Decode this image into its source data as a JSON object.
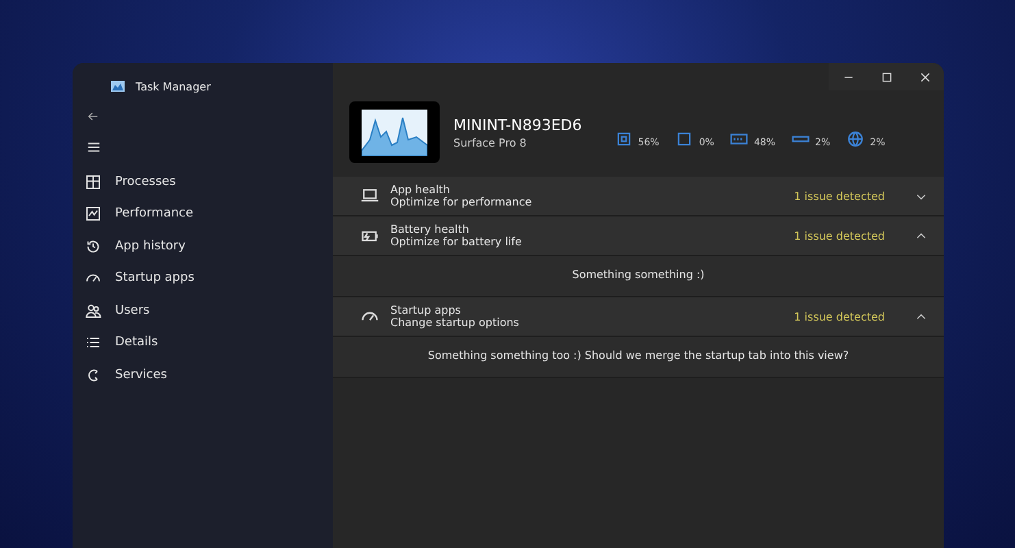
{
  "window": {
    "title": "Task Manager"
  },
  "sidebar": {
    "items": [
      {
        "label": "Processes"
      },
      {
        "label": "Performance"
      },
      {
        "label": "App history"
      },
      {
        "label": "Startup apps"
      },
      {
        "label": "Users"
      },
      {
        "label": "Details"
      },
      {
        "label": "Services"
      }
    ]
  },
  "device": {
    "name": "MININT-N893ED6",
    "model": "Surface Pro 8"
  },
  "metrics": [
    {
      "reading": "56%"
    },
    {
      "reading": "0%"
    },
    {
      "reading": "48%"
    },
    {
      "reading": "2%"
    },
    {
      "reading": "2%"
    }
  ],
  "sections": [
    {
      "title": "App health",
      "subtitle": "Optimize for performance",
      "status": "1 issue detected",
      "expanded": false
    },
    {
      "title": "Battery health",
      "subtitle": "Optimize for battery life",
      "status": "1 issue detected",
      "expanded": true,
      "body": "Something something :)"
    },
    {
      "title": "Startup apps",
      "subtitle": "Change startup options",
      "status": "1 issue detected",
      "expanded": true,
      "body": "Something something too :) Should we merge the startup tab into this view?"
    }
  ]
}
